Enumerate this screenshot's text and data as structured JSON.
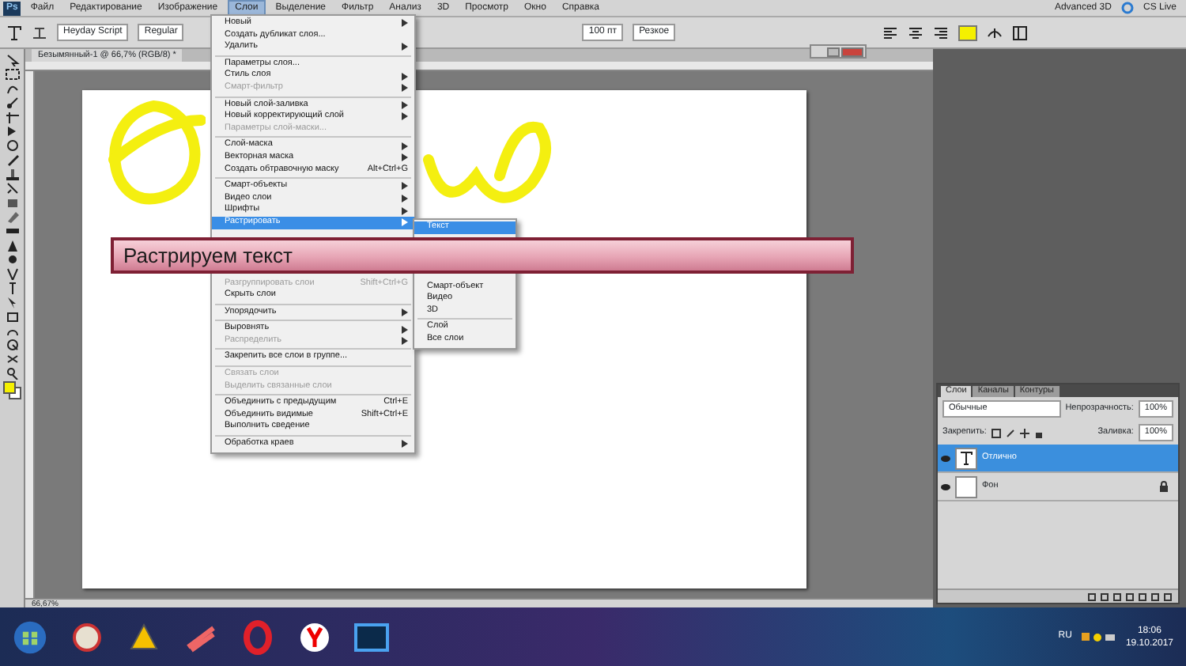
{
  "app_bar": {
    "logo": "Ps",
    "menus": [
      {
        "label": "Файл",
        "selected": false
      },
      {
        "label": "Редактирование",
        "selected": false
      },
      {
        "label": "Изображение",
        "selected": false
      },
      {
        "label": "Слои",
        "selected": true
      },
      {
        "label": "Выделение",
        "selected": false
      },
      {
        "label": "Фильтр",
        "selected": false
      },
      {
        "label": "Анализ",
        "selected": false
      },
      {
        "label": "3D",
        "selected": false
      },
      {
        "label": "Просмотр",
        "selected": false
      },
      {
        "label": "Окно",
        "selected": false
      },
      {
        "label": "Справка",
        "selected": false
      }
    ],
    "workspace": "Advanced 3D",
    "cs_live": "CS Live"
  },
  "options_bar": {
    "font_family": "Heyday Script",
    "font_style": "Regular",
    "font_size": "100 пт",
    "anti_alias": "Резкое"
  },
  "document": {
    "tab": "Безымянный-1 @ 66,7% (RGB/8) *",
    "zoom": "66,67%"
  },
  "layer_menu": {
    "items_top": [
      {
        "kind": "item",
        "label": "Новый",
        "submenu": true,
        "disabled": false,
        "selected": false
      },
      {
        "kind": "item",
        "label": "Создать дубликат слоя...",
        "submenu": false,
        "disabled": false,
        "selected": false
      },
      {
        "kind": "item",
        "label": "Удалить",
        "submenu": true,
        "disabled": false,
        "selected": false
      },
      {
        "kind": "separator"
      },
      {
        "kind": "item",
        "label": "Параметры слоя...",
        "submenu": false,
        "disabled": false,
        "selected": false
      },
      {
        "kind": "item",
        "label": "Стиль слоя",
        "submenu": true,
        "disabled": false,
        "selected": false
      },
      {
        "kind": "item",
        "label": "Смарт-фильтр",
        "submenu": true,
        "disabled": true,
        "selected": false
      },
      {
        "kind": "separator"
      },
      {
        "kind": "item",
        "label": "Новый слой-заливка",
        "submenu": true,
        "disabled": false,
        "selected": false
      },
      {
        "kind": "item",
        "label": "Новый корректирующий слой",
        "submenu": true,
        "disabled": false,
        "selected": false
      },
      {
        "kind": "item",
        "label": "Параметры слой-маски...",
        "submenu": false,
        "disabled": true,
        "selected": false
      },
      {
        "kind": "separator"
      },
      {
        "kind": "item",
        "label": "Слой-маска",
        "submenu": true,
        "disabled": false,
        "selected": false
      },
      {
        "kind": "item",
        "label": "Векторная маска",
        "submenu": true,
        "disabled": false,
        "selected": false
      },
      {
        "kind": "item",
        "label": "Создать обтравочную маску",
        "shortcut": "Alt+Ctrl+G",
        "submenu": false,
        "disabled": false,
        "selected": false
      },
      {
        "kind": "separator"
      },
      {
        "kind": "item",
        "label": "Смарт-объекты",
        "submenu": true,
        "disabled": false,
        "selected": false
      },
      {
        "kind": "item",
        "label": "Видео слои",
        "submenu": true,
        "disabled": false,
        "selected": false
      },
      {
        "kind": "item",
        "label": "Шрифты",
        "submenu": true,
        "disabled": false,
        "selected": false
      },
      {
        "kind": "item",
        "label": "Растрировать",
        "submenu": true,
        "disabled": false,
        "selected": true
      }
    ],
    "items_bottom": [
      {
        "kind": "item",
        "label": "Разгруппировать слои",
        "shortcut": "Shift+Ctrl+G",
        "submenu": false,
        "disabled": true,
        "selected": false
      },
      {
        "kind": "item",
        "label": "Скрыть слои",
        "submenu": false,
        "disabled": false,
        "selected": false
      },
      {
        "kind": "separator"
      },
      {
        "kind": "item",
        "label": "Упорядочить",
        "submenu": true,
        "disabled": false,
        "selected": false
      },
      {
        "kind": "separator"
      },
      {
        "kind": "item",
        "label": "Выровнять",
        "submenu": true,
        "disabled": false,
        "selected": false
      },
      {
        "kind": "item",
        "label": "Распределить",
        "submenu": true,
        "disabled": true,
        "selected": false
      },
      {
        "kind": "separator"
      },
      {
        "kind": "item",
        "label": "Закрепить все слои в группе...",
        "submenu": false,
        "disabled": false,
        "selected": false
      },
      {
        "kind": "separator"
      },
      {
        "kind": "item",
        "label": "Связать слои",
        "submenu": false,
        "disabled": true,
        "selected": false
      },
      {
        "kind": "item",
        "label": "Выделить связанные слои",
        "submenu": false,
        "disabled": true,
        "selected": false
      },
      {
        "kind": "separator"
      },
      {
        "kind": "item",
        "label": "Объединить с предыдущим",
        "shortcut": "Ctrl+E",
        "submenu": false,
        "disabled": false,
        "selected": false
      },
      {
        "kind": "item",
        "label": "Объединить видимые",
        "shortcut": "Shift+Ctrl+E",
        "submenu": false,
        "disabled": false,
        "selected": false
      },
      {
        "kind": "item",
        "label": "Выполнить сведение",
        "submenu": false,
        "disabled": false,
        "selected": false
      },
      {
        "kind": "separator"
      },
      {
        "kind": "item",
        "label": "Обработка краев",
        "submenu": true,
        "disabled": false,
        "selected": false
      }
    ]
  },
  "raster_submenu": {
    "items_top": [
      {
        "kind": "item",
        "label": "Текст",
        "submenu": false,
        "disabled": false,
        "selected": true
      }
    ],
    "items_bottom": [
      {
        "kind": "item",
        "label": "Смарт-объект",
        "submenu": false,
        "disabled": false,
        "selected": false
      },
      {
        "kind": "item",
        "label": "Видео",
        "submenu": false,
        "disabled": false,
        "selected": false
      },
      {
        "kind": "item",
        "label": "3D",
        "submenu": false,
        "disabled": false,
        "selected": false
      },
      {
        "kind": "separator"
      },
      {
        "kind": "item",
        "label": "Слой",
        "submenu": false,
        "disabled": false,
        "selected": false
      },
      {
        "kind": "item",
        "label": "Все слои",
        "submenu": false,
        "disabled": false,
        "selected": false
      }
    ]
  },
  "banner": "Растрируем текст",
  "layers_panel": {
    "tabs": [
      {
        "label": "Слои",
        "selected": true
      },
      {
        "label": "Каналы",
        "selected": false
      },
      {
        "label": "Контуры",
        "selected": false
      }
    ],
    "blend_mode": "Обычные",
    "opacity_label": "Непрозрачность:",
    "opacity": "100%",
    "lock_label": "Закрепить:",
    "fill_label": "Заливка:",
    "fill": "100%",
    "layers": [
      {
        "name": "Отлично",
        "kind": "text",
        "selected": true,
        "visible": true
      },
      {
        "name": "Фон",
        "kind": "background",
        "selected": false,
        "visible": true
      }
    ]
  },
  "taskbar": {
    "language": "RU",
    "time": "18:06",
    "date": "19.10.2017"
  }
}
